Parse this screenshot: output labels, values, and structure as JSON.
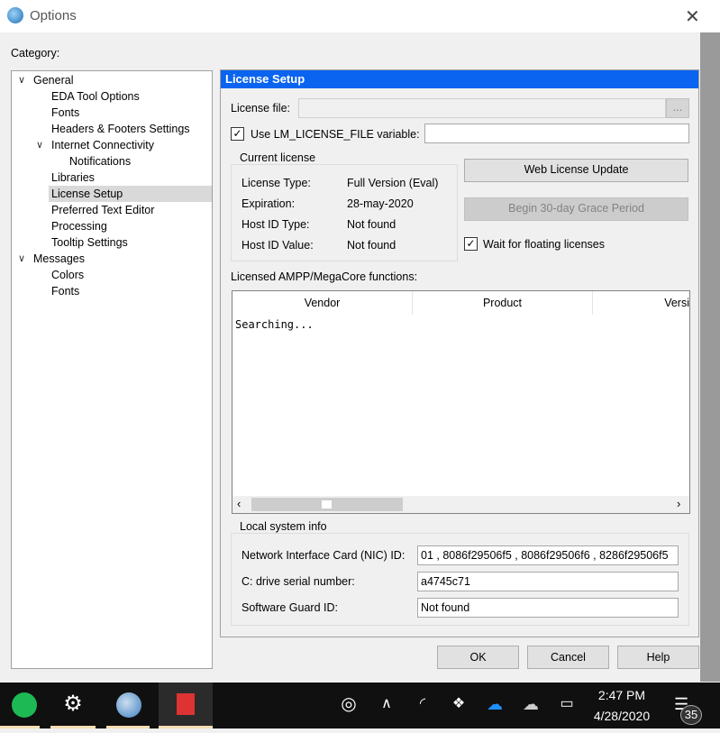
{
  "window": {
    "title": "Options",
    "close": "✕"
  },
  "category_label": "Category:",
  "tree": [
    {
      "label": "General",
      "level": 0,
      "expanded": true
    },
    {
      "label": "EDA Tool Options",
      "level": 1
    },
    {
      "label": "Fonts",
      "level": 1
    },
    {
      "label": "Headers & Footers Settings",
      "level": 1
    },
    {
      "label": "Internet Connectivity",
      "level": 1,
      "expanded": true
    },
    {
      "label": "Notifications",
      "level": 2
    },
    {
      "label": "Libraries",
      "level": 1
    },
    {
      "label": "License Setup",
      "level": 1,
      "selected": true
    },
    {
      "label": "Preferred Text Editor",
      "level": 1
    },
    {
      "label": "Processing",
      "level": 1
    },
    {
      "label": "Tooltip Settings",
      "level": 1
    },
    {
      "label": "Messages",
      "level": 0,
      "expanded": true
    },
    {
      "label": "Colors",
      "level": 1
    },
    {
      "label": "Fonts",
      "level": 1
    }
  ],
  "panel": {
    "title": "License Setup",
    "license_file_label": "License file:",
    "license_file_value": "",
    "browse": "...",
    "use_lm_label": "Use LM_LICENSE_FILE variable:",
    "use_lm_checked": true,
    "use_lm_value": "",
    "current_license": {
      "title": "Current license",
      "rows": [
        {
          "k": "License Type:",
          "v": "Full Version (Eval)"
        },
        {
          "k": "Expiration:",
          "v": "28-may-2020"
        },
        {
          "k": "Host ID Type:",
          "v": "Not found"
        },
        {
          "k": "Host ID Value:",
          "v": "Not found"
        }
      ]
    },
    "web_update": "Web License Update",
    "grace": "Begin 30-day Grace Period",
    "wait_label": "Wait for floating licenses",
    "wait_checked": true,
    "functions_label": "Licensed AMPP/MegaCore functions:",
    "columns": [
      "Vendor",
      "Product",
      "Versi"
    ],
    "status": "Searching...",
    "local": {
      "title": "Local system info",
      "rows": [
        {
          "k": "Network Interface Card (NIC) ID:",
          "v": "01 , 8086f29506f5 , 8086f29506f6 , 8286f29506f5"
        },
        {
          "k": "C: drive serial number:",
          "v": "a4745c71"
        },
        {
          "k": "Software Guard ID:",
          "v": "Not found"
        }
      ]
    }
  },
  "buttons": {
    "ok": "OK",
    "cancel": "Cancel",
    "help": "Help"
  },
  "taskbar": {
    "time": "2:47 PM",
    "date": "4/28/2020",
    "notifications": "35"
  }
}
